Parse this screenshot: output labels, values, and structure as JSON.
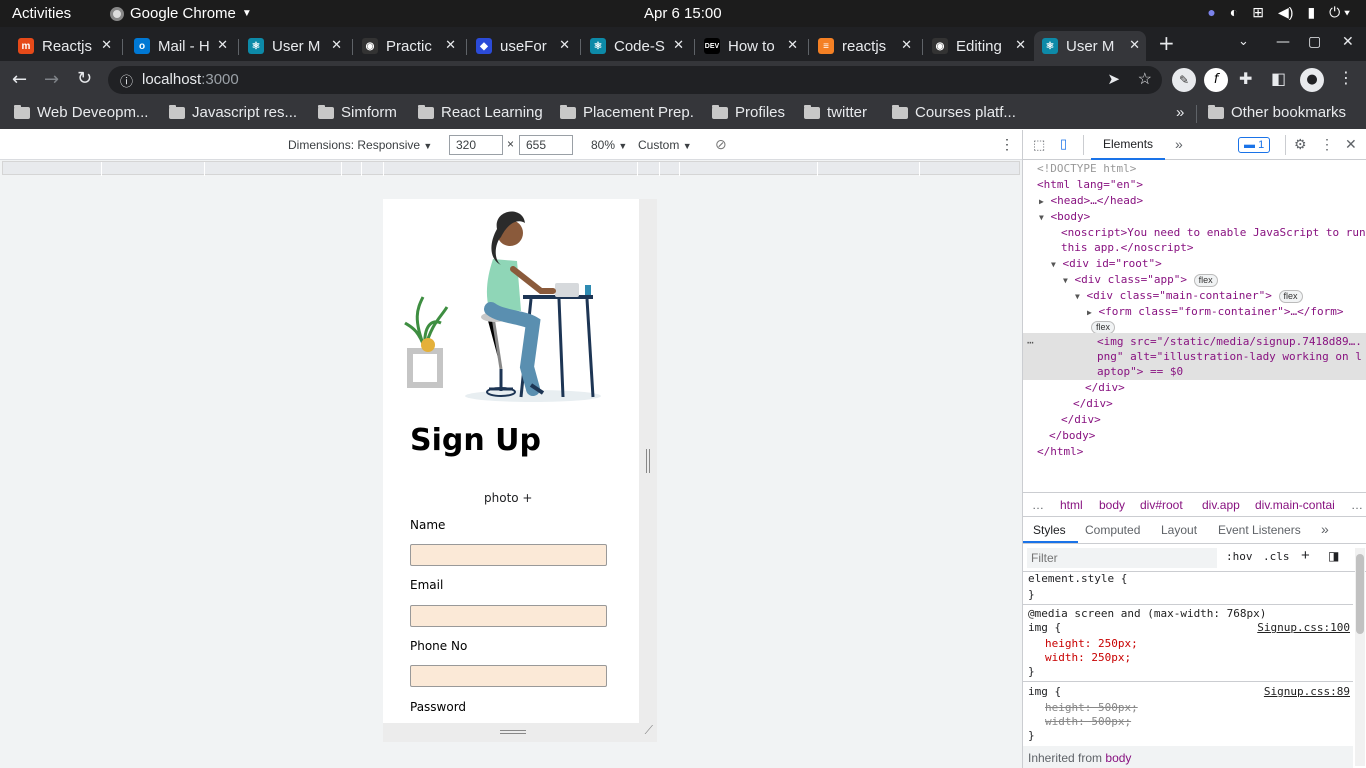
{
  "system": {
    "activities": "Activities",
    "app_name": "Google Chrome",
    "clock": "Apr 6  15:00"
  },
  "tabs": [
    {
      "title": "Reactjs",
      "color": "#e64a19"
    },
    {
      "title": "Mail - H",
      "color": "#0078d4"
    },
    {
      "title": "User M",
      "color": "#0d8aa8"
    },
    {
      "title": "Practic",
      "color": "#333333"
    },
    {
      "title": "useFor",
      "color": "#2b4bd8"
    },
    {
      "title": "Code-S",
      "color": "#0d8aa8"
    },
    {
      "title": "How to",
      "color": "#000000"
    },
    {
      "title": "reactjs",
      "color": "#f48024"
    },
    {
      "title": "Editing",
      "color": "#333333"
    },
    {
      "title": "User M",
      "color": "#0d8aa8"
    }
  ],
  "address": {
    "host": "localhost",
    "port": ":3000"
  },
  "bookmarks": [
    "Web Deveopm...",
    "Javascript res...",
    "Simform",
    "React Learning",
    "Placement Prep.",
    "Profiles",
    "twitter",
    "Courses platf...",
    "Other bookmarks"
  ],
  "device_toolbar": {
    "dimensions": "Dimensions: Responsive",
    "width": "320",
    "times": "×",
    "height": "655",
    "zoom": "80%",
    "throttle": "Custom"
  },
  "page": {
    "heading": "Sign Up",
    "photo_label": "photo +",
    "fields": [
      "Name",
      "Email",
      "Phone No",
      "Password"
    ]
  },
  "devtools": {
    "tab_elements": "Elements",
    "issues_count": "1",
    "dom": {
      "doctype": "<!DOCTYPE html>",
      "html_open": "<html lang=\"en\">",
      "head": "<head>…</head>",
      "body_open": "<body>",
      "noscript_1": "<noscript>You need to enable JavaScript to run",
      "noscript_2": "this app.</noscript>",
      "root": "<div id=\"root\">",
      "app": "<div class=\"app\">",
      "main": "<div class=\"main-container\">",
      "form": "<form class=\"form-container\">…</form>",
      "flex": "flex",
      "img_1": "<img src=\"/static/media/signup.7418d89….",
      "img_2": "png\" alt=\"illustration-lady working on l",
      "img_3": "aptop\"> == $0",
      "div_close_1": "</div>",
      "div_close_2": "</div>",
      "div_close_3": "</div>",
      "body_close": "</body>",
      "html_close": "</html>"
    },
    "breadcrumbs": [
      "…",
      "html",
      "body",
      "div#root",
      "div.app",
      "div.main-contai",
      "…"
    ],
    "style_tabs": [
      "Styles",
      "Computed",
      "Layout",
      "Event Listeners"
    ],
    "filter_placeholder": "Filter",
    "hov": ":hov",
    "cls": ".cls",
    "styles": {
      "element_style": "element.style {",
      "close": "}",
      "media": "@media screen and (max-width: 768px)",
      "rule1_selector": "img {",
      "rule1_src": "Signup.css:100",
      "rule1_height": "height: 250px;",
      "rule1_width": "width: 250px;",
      "rule2_selector": "img {",
      "rule2_src": "Signup.css:89",
      "rule2_height": "height: 500px;",
      "rule2_width": "width: 500px;",
      "inherited": "Inherited from",
      "inherited_el": "body"
    }
  }
}
